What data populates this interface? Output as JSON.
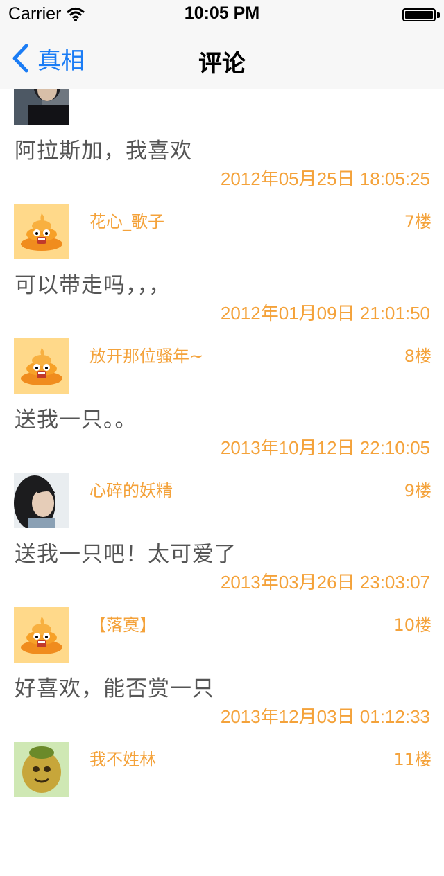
{
  "status_bar": {
    "carrier": "Carrier",
    "time": "10:05 PM"
  },
  "nav": {
    "back_label": "真相",
    "title": "评论"
  },
  "colors": {
    "accent": "#f4a23a",
    "nav_blue": "#1a7cf5",
    "comment_text": "#555555"
  },
  "comments": [
    {
      "username": "",
      "floor": "",
      "text": "阿拉斯加，我喜欢",
      "time": "2012年05月25日 18:05:25",
      "avatar": "photo-avatar-man"
    },
    {
      "username": "花心_歌子",
      "floor": "7楼",
      "text": "可以带走吗，，，",
      "time": "2012年01月09日 21:01:50",
      "avatar": "poop-emoji-avatar"
    },
    {
      "username": "放开那位骚年~",
      "floor": "8楼",
      "text": "送我一只。。",
      "time": "2013年10月12日 22:10:05",
      "avatar": "poop-emoji-avatar"
    },
    {
      "username": "心碎的妖精",
      "floor": "9楼",
      "text": "送我一只吧！太可爱了",
      "time": "2013年03月26日 23:03:07",
      "avatar": "photo-avatar-woman"
    },
    {
      "username": "【落寞】",
      "floor": "10楼",
      "text": "好喜欢，能否赏一只",
      "time": "2013年12月03日 01:12:33",
      "avatar": "poop-emoji-avatar"
    },
    {
      "username": "我不姓林",
      "floor": "11楼",
      "text": "",
      "time": "",
      "avatar": "cartoon-avatar"
    }
  ]
}
